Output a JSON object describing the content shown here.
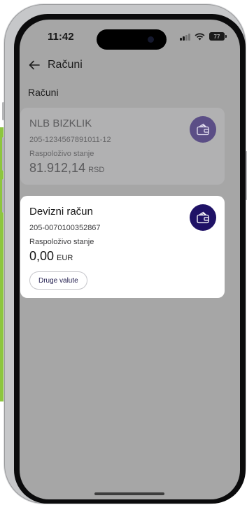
{
  "status_bar": {
    "time": "11:42",
    "battery_level": "77"
  },
  "header": {
    "title": "Računi",
    "back_icon": "arrow-left-icon"
  },
  "section": {
    "label": "Računi"
  },
  "accounts": [
    {
      "name": "NLB BIZKLIK",
      "number": "205-1234567891011-12",
      "available_label": "Raspoloživo stanje",
      "amount": "81.912,14",
      "currency": "RSD",
      "icon": "wallet-icon",
      "state": "dimmed"
    },
    {
      "name": "Devizni račun",
      "number": "205-0070100352867",
      "available_label": "Raspoloživo stanje",
      "amount": "0,00",
      "currency": "EUR",
      "icon": "wallet-icon",
      "state": "highlighted",
      "button_label": "Druge valute"
    }
  ],
  "colors": {
    "accent_dark": "#1f1266",
    "accent_muted": "#5b4e86",
    "overlay_background": "#a6a6a6",
    "left_strip_green": "#8dc63f"
  }
}
